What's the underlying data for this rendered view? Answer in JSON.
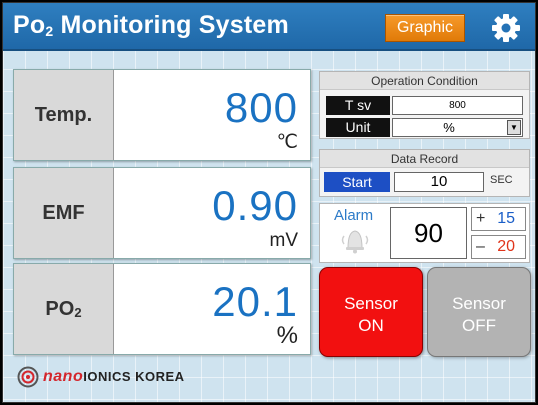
{
  "header": {
    "title_main": "Po",
    "title_sub": "2",
    "title_rest": " Monitoring System",
    "graphic_label": "Graphic",
    "settings_icon": "gear-icon"
  },
  "measurements": {
    "temp": {
      "label": "Temp.",
      "value": "800",
      "unit": "℃"
    },
    "emf": {
      "label": "EMF",
      "value": "0.90",
      "unit": "mV"
    },
    "po2": {
      "label_main": "PO",
      "label_sub": "2",
      "value": "20.1",
      "unit": "%"
    }
  },
  "operation": {
    "title": "Operation Condition",
    "tsv_label": "T sv",
    "tsv_value": "800",
    "unit_label": "Unit",
    "unit_value": "%"
  },
  "record": {
    "title": "Data Record",
    "start_label": "Start",
    "interval": "10",
    "interval_unit": "SEC"
  },
  "alarm": {
    "label": "Alarm",
    "value": "90",
    "plus_sign": "+",
    "plus_value": "15",
    "minus_sign": "–",
    "minus_value": "20",
    "icon": "alarm-bell-icon"
  },
  "sensor": {
    "on_label_1": "Sensor",
    "on_label_2": "ON",
    "off_label_1": "Sensor",
    "off_label_2": "OFF"
  },
  "brand": {
    "nano": "nano",
    "rest": "IONICS KOREA"
  },
  "colors": {
    "header_blue": "#2f7fc0",
    "value_blue": "#1a72c2",
    "graphic_orange": "#f0901e",
    "sensor_on_red": "#f21010",
    "sensor_off_gray": "#b3b3b3",
    "minus_red": "#e0341a",
    "plus_blue": "#1a5ec8"
  }
}
